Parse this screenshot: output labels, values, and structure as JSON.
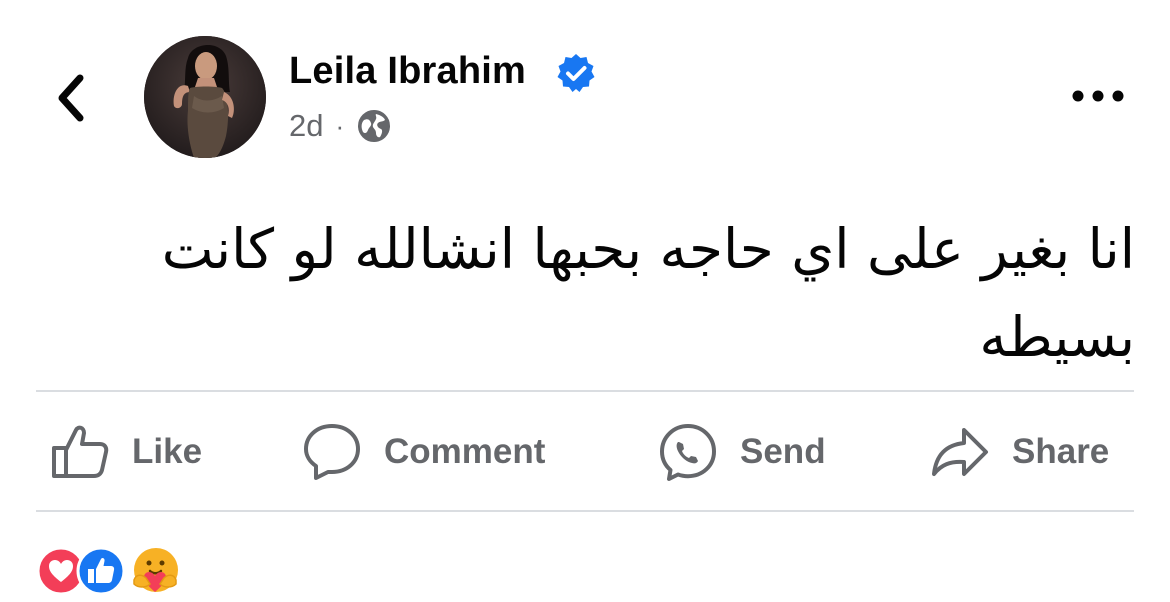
{
  "header": {
    "author_name": "Leila Ibrahim",
    "time_ago": "2d",
    "separator": "·",
    "audience_icon": "globe-icon",
    "verified_icon": "verified-badge-icon",
    "back_icon": "chevron-left-icon",
    "more_icon": "more-horizontal-icon"
  },
  "post": {
    "text": "انا بغير على اي حاجه بحبها انشالله لو كانت بسيطه"
  },
  "actions": [
    {
      "label": "Like",
      "icon": "thumbs-up-icon"
    },
    {
      "label": "Comment",
      "icon": "comment-bubble-icon"
    },
    {
      "label": "Send",
      "icon": "messenger-send-icon"
    },
    {
      "label": "Share",
      "icon": "share-arrow-icon"
    }
  ],
  "reactions": [
    "love",
    "like",
    "care"
  ],
  "colors": {
    "accent_blue": "#1877f2",
    "love_red": "#f33e58",
    "care_yellow": "#f7b125",
    "secondary_text": "#65676b",
    "divider": "#dadde1"
  }
}
